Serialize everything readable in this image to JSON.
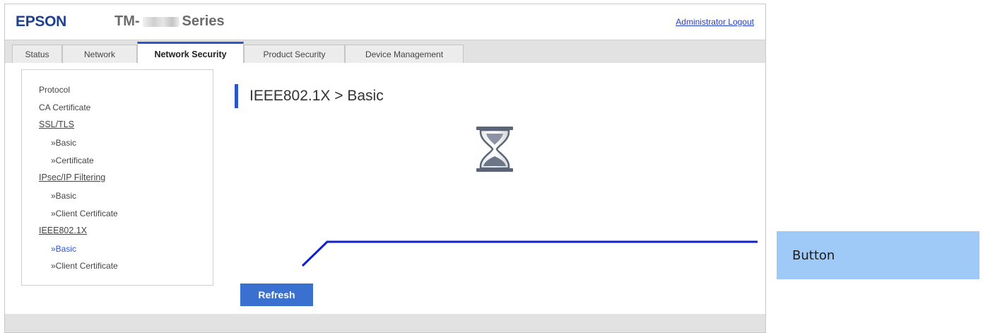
{
  "header": {
    "logo": "EPSON",
    "model_prefix": "TM-",
    "model_suffix": "Series",
    "admin_logout": "Administrator Logout"
  },
  "tabs": [
    {
      "label": "Status"
    },
    {
      "label": "Network"
    },
    {
      "label": "Network Security",
      "active": true
    },
    {
      "label": "Product Security"
    },
    {
      "label": "Device Management"
    }
  ],
  "sidebar": {
    "items": [
      {
        "label": "Protocol"
      },
      {
        "label": "CA Certificate"
      },
      {
        "label": "SSL/TLS"
      },
      {
        "label": "»Basic"
      },
      {
        "label": "»Certificate"
      },
      {
        "label": "IPsec/IP Filtering"
      },
      {
        "label": "»Basic"
      },
      {
        "label": "»Client Certificate"
      },
      {
        "label": "IEEE802.1X"
      },
      {
        "label": "»Basic",
        "active": true
      },
      {
        "label": "»Client Certificate"
      }
    ]
  },
  "main": {
    "title": "IEEE802.1X > Basic",
    "loading_icon": "hourglass-icon",
    "refresh_label": "Refresh"
  },
  "callout": {
    "label": "Button"
  },
  "colors": {
    "accent": "#2a56c8",
    "button": "#3a70cf",
    "logo": "#1f3f8f",
    "callout_bg": "#9fc9f7",
    "callout_line": "#1020d0"
  }
}
